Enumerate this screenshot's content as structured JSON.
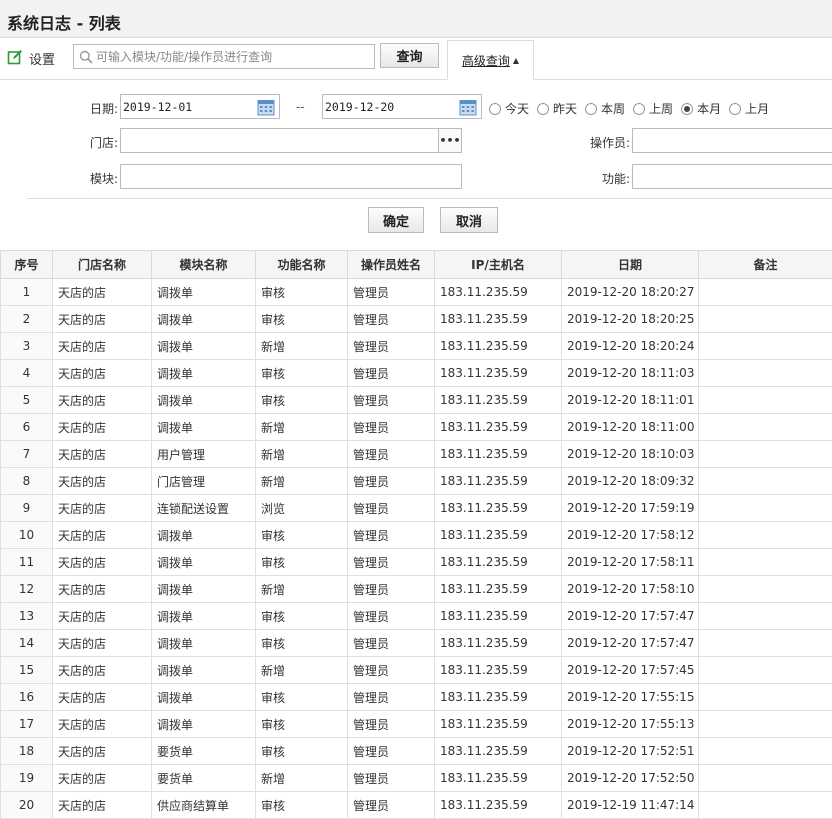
{
  "header": {
    "title": "系统日志 - 列表"
  },
  "toolbar": {
    "settings_label": "设置",
    "search_placeholder": "可输入模块/功能/操作员进行查询",
    "search_value": "",
    "query_label": "查询",
    "advanced_label": "高级查询",
    "advanced_caret": "▲"
  },
  "filters": {
    "date_label": "日期:",
    "date_from": "2019-12-01",
    "date_sep": "--",
    "date_to": "2019-12-20",
    "ranges": [
      {
        "label": "今天",
        "selected": false
      },
      {
        "label": "昨天",
        "selected": false
      },
      {
        "label": "本周",
        "selected": false
      },
      {
        "label": "上周",
        "selected": false
      },
      {
        "label": "本月",
        "selected": true
      },
      {
        "label": "上月",
        "selected": false
      }
    ],
    "store_label": "门店:",
    "store_value": "",
    "operator_label": "操作员:",
    "operator_value": "",
    "module_label": "模块:",
    "module_value": "",
    "function_label": "功能:",
    "function_value": "",
    "confirm_label": "确定",
    "cancel_label": "取消"
  },
  "table": {
    "columns": [
      "序号",
      "门店名称",
      "模块名称",
      "功能名称",
      "操作员姓名",
      "IP/主机名",
      "日期",
      "备注"
    ],
    "rows": [
      [
        "1",
        "天店的店",
        "调拨单",
        "审核",
        "管理员",
        "183.11.235.59",
        "2019-12-20 18:20:27",
        ""
      ],
      [
        "2",
        "天店的店",
        "调拨单",
        "审核",
        "管理员",
        "183.11.235.59",
        "2019-12-20 18:20:25",
        ""
      ],
      [
        "3",
        "天店的店",
        "调拨单",
        "新增",
        "管理员",
        "183.11.235.59",
        "2019-12-20 18:20:24",
        ""
      ],
      [
        "4",
        "天店的店",
        "调拨单",
        "审核",
        "管理员",
        "183.11.235.59",
        "2019-12-20 18:11:03",
        ""
      ],
      [
        "5",
        "天店的店",
        "调拨单",
        "审核",
        "管理员",
        "183.11.235.59",
        "2019-12-20 18:11:01",
        ""
      ],
      [
        "6",
        "天店的店",
        "调拨单",
        "新增",
        "管理员",
        "183.11.235.59",
        "2019-12-20 18:11:00",
        ""
      ],
      [
        "7",
        "天店的店",
        "用户管理",
        "新增",
        "管理员",
        "183.11.235.59",
        "2019-12-20 18:10:03",
        ""
      ],
      [
        "8",
        "天店的店",
        "门店管理",
        "新增",
        "管理员",
        "183.11.235.59",
        "2019-12-20 18:09:32",
        ""
      ],
      [
        "9",
        "天店的店",
        "连锁配送设置",
        "浏览",
        "管理员",
        "183.11.235.59",
        "2019-12-20 17:59:19",
        ""
      ],
      [
        "10",
        "天店的店",
        "调拨单",
        "审核",
        "管理员",
        "183.11.235.59",
        "2019-12-20 17:58:12",
        ""
      ],
      [
        "11",
        "天店的店",
        "调拨单",
        "审核",
        "管理员",
        "183.11.235.59",
        "2019-12-20 17:58:11",
        ""
      ],
      [
        "12",
        "天店的店",
        "调拨单",
        "新增",
        "管理员",
        "183.11.235.59",
        "2019-12-20 17:58:10",
        ""
      ],
      [
        "13",
        "天店的店",
        "调拨单",
        "审核",
        "管理员",
        "183.11.235.59",
        "2019-12-20 17:57:47",
        ""
      ],
      [
        "14",
        "天店的店",
        "调拨单",
        "审核",
        "管理员",
        "183.11.235.59",
        "2019-12-20 17:57:47",
        ""
      ],
      [
        "15",
        "天店的店",
        "调拨单",
        "新增",
        "管理员",
        "183.11.235.59",
        "2019-12-20 17:57:45",
        ""
      ],
      [
        "16",
        "天店的店",
        "调拨单",
        "审核",
        "管理员",
        "183.11.235.59",
        "2019-12-20 17:55:15",
        ""
      ],
      [
        "17",
        "天店的店",
        "调拨单",
        "审核",
        "管理员",
        "183.11.235.59",
        "2019-12-20 17:55:13",
        ""
      ],
      [
        "18",
        "天店的店",
        "要货单",
        "审核",
        "管理员",
        "183.11.235.59",
        "2019-12-20 17:52:51",
        ""
      ],
      [
        "19",
        "天店的店",
        "要货单",
        "新增",
        "管理员",
        "183.11.235.59",
        "2019-12-20 17:52:50",
        ""
      ],
      [
        "20",
        "天店的店",
        "供应商结算单",
        "审核",
        "管理员",
        "183.11.235.59",
        "2019-12-19 11:47:14",
        ""
      ]
    ]
  },
  "colors": {
    "accent_green": "#2e9a3a",
    "calendar_blue": "#5b8fc9"
  }
}
